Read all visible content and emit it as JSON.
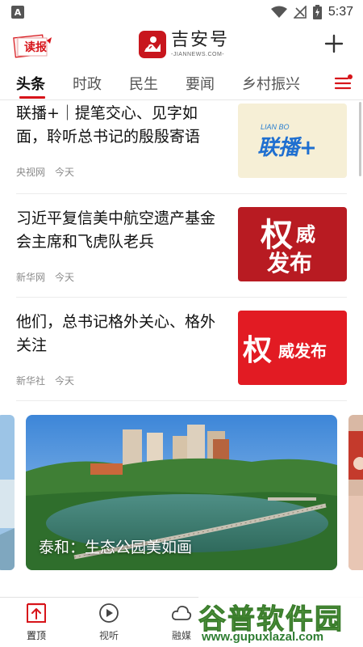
{
  "status_bar": {
    "time": "5:37",
    "app_badge": "A"
  },
  "header": {
    "read_badge": "读报",
    "logo_title": "吉安号",
    "logo_sub": "-JIANNEWS.COM-"
  },
  "tabs": [
    {
      "label": "头条",
      "active": true
    },
    {
      "label": "时政",
      "active": false
    },
    {
      "label": "民生",
      "active": false
    },
    {
      "label": "要闻",
      "active": false
    },
    {
      "label": "乡村振兴",
      "active": false
    }
  ],
  "feed": [
    {
      "title": "联播+｜提笔交心、见字如面，聆听总书记的殷殷寄语",
      "source": "央视网",
      "time": "今天",
      "thumb_label": "联播+",
      "thumb_sub": "LIAN BO"
    },
    {
      "title": "习近平复信美中航空遗产基金会主席和飞虎队老兵",
      "source": "新华网",
      "time": "今天",
      "thumb_label_a": "权",
      "thumb_label_b": "威",
      "thumb_label_c": "发布"
    },
    {
      "title": "他们，总书记格外关心、格外关注",
      "source": "新华社",
      "time": "今天",
      "thumb_label_a": "权",
      "thumb_label_b": "威发布"
    }
  ],
  "carousel": {
    "caption": "泰和：生态公园美如画"
  },
  "bottom_nav": [
    {
      "label": "置顶",
      "icon": "top-pin-icon",
      "active": true
    },
    {
      "label": "视听",
      "icon": "play-circle-icon",
      "active": false
    },
    {
      "label": "融媒",
      "icon": "cloud-icon",
      "active": false
    }
  ],
  "watermark": {
    "main": "谷普软件园",
    "url": "www.gupuxlazal.com"
  },
  "colors": {
    "accent": "#d7141a",
    "brand": "#c8161d",
    "watermark": "#6aa84f"
  }
}
